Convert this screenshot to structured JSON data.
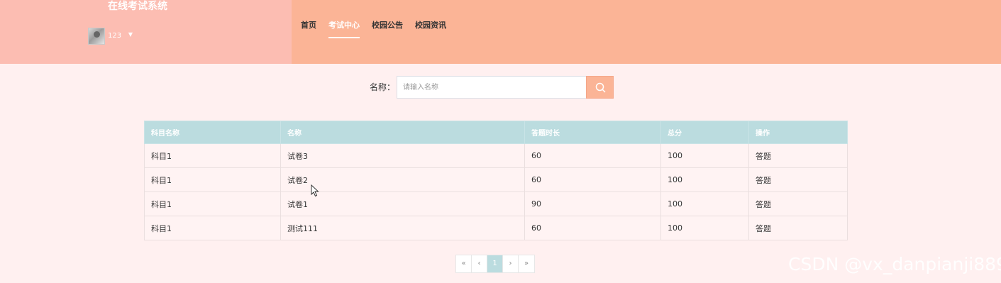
{
  "header": {
    "site_title": "在线考试系统",
    "username": "123",
    "nav": [
      {
        "label": "首页",
        "active": false
      },
      {
        "label": "考试中心",
        "active": true
      },
      {
        "label": "校园公告",
        "active": false
      },
      {
        "label": "校园资讯",
        "active": false
      }
    ],
    "colors": {
      "header_bg": "#fbb496",
      "brand_bg": "#fcbdb2"
    }
  },
  "search": {
    "label": "名称：",
    "placeholder": "请输入名称",
    "value": "",
    "button_icon": "search-icon"
  },
  "table": {
    "columns": [
      "科目名称",
      "名称",
      "答题时长",
      "总分",
      "操作"
    ],
    "rows": [
      [
        "科目1",
        "试卷3",
        "60",
        "100",
        "答题"
      ],
      [
        "科目1",
        "试卷2",
        "60",
        "100",
        "答题"
      ],
      [
        "科目1",
        "试卷1",
        "90",
        "100",
        "答题"
      ],
      [
        "科目1",
        "测试111",
        "60",
        "100",
        "答题"
      ]
    ]
  },
  "pagination": {
    "first": "«",
    "prev": "‹",
    "current": "1",
    "next": "›",
    "last": "»"
  },
  "watermark": "CSDN @vx_danpianji889"
}
